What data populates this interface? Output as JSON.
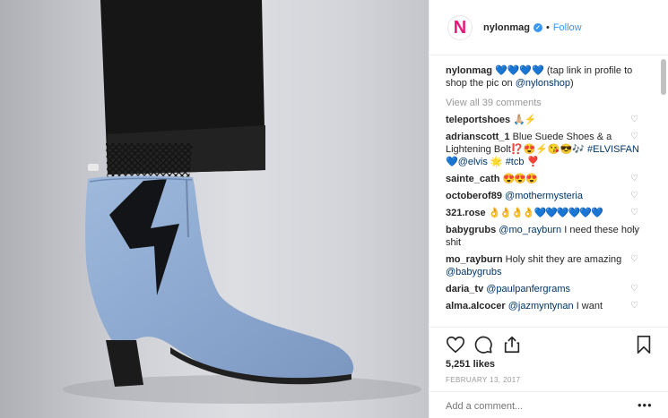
{
  "header": {
    "avatar_letter": "N",
    "username": "nylonmag",
    "verified_mark": "✓",
    "separator": "•",
    "follow_label": "Follow"
  },
  "caption": {
    "username": "nylonmag",
    "emojis": "💙💙💙💙",
    "text": "(tap link in profile to shop the pic on",
    "mention": "@nylonshop",
    "suffix": ")"
  },
  "view_all_label": "View all 39 comments",
  "comments": [
    {
      "user": "teleportshoes",
      "parts": [
        {
          "t": "🙏🏼⚡️",
          "c": "emo"
        }
      ]
    },
    {
      "user": "adrianscott_1",
      "parts": [
        {
          "t": "Blue Suede Shoes & a Lightening Bolt⁉️😍⚡️😘😎🎶 ",
          "c": ""
        },
        {
          "t": "#ELVISFAN",
          "c": "link"
        },
        {
          "t": " 💙",
          "c": ""
        },
        {
          "t": "@elvis",
          "c": "link"
        },
        {
          "t": " 🌟 ",
          "c": ""
        },
        {
          "t": "#tcb",
          "c": "link"
        },
        {
          "t": " ❣️",
          "c": ""
        }
      ]
    },
    {
      "user": "sainte_cath",
      "parts": [
        {
          "t": "😍😍😍",
          "c": "emo"
        }
      ]
    },
    {
      "user": "octoberof89",
      "parts": [
        {
          "t": "@mothermysteria",
          "c": "link"
        }
      ]
    },
    {
      "user": "321.rose",
      "parts": [
        {
          "t": "👌👌👌👌💙💙💙💙💙💙",
          "c": "emo"
        }
      ]
    },
    {
      "user": "babygrubs",
      "parts": [
        {
          "t": "@mo_rayburn",
          "c": "link"
        },
        {
          "t": " I need these holy shit",
          "c": ""
        }
      ]
    },
    {
      "user": "mo_rayburn",
      "parts": [
        {
          "t": "Holy shit they are amazing ",
          "c": ""
        },
        {
          "t": "@babygrubs",
          "c": "link"
        }
      ]
    },
    {
      "user": "daria_tv",
      "parts": [
        {
          "t": "@paulpanfergrams",
          "c": "link"
        }
      ]
    },
    {
      "user": "alma.alcocer",
      "parts": [
        {
          "t": "@jazmyntynan",
          "c": "link"
        },
        {
          "t": " I want",
          "c": ""
        }
      ]
    }
  ],
  "heart_glyph": "♡",
  "actions": {
    "like_icon": "heart-icon",
    "comment_icon": "comment-icon",
    "share_icon": "share-icon",
    "save_icon": "bookmark-icon"
  },
  "likes_label": "5,251 likes",
  "date_label": "FEBRUARY 13, 2017",
  "add_comment_placeholder": "Add a comment...",
  "more_label": "•••",
  "colors": {
    "brand": "#e8197d",
    "link": "#003569",
    "follow": "#3897f0",
    "muted": "#999999",
    "boot": "#8ea9cf"
  }
}
